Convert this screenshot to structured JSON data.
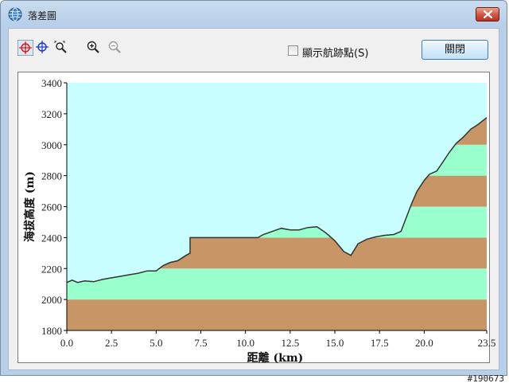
{
  "window": {
    "title": "落差圖"
  },
  "toolbar": {
    "tools": [
      {
        "name": "crosshair-red-icon"
      },
      {
        "name": "crosshair-blue-icon"
      },
      {
        "name": "zoom-area-icon"
      },
      {
        "name": "zoom-in-icon"
      },
      {
        "name": "zoom-out-icon"
      }
    ],
    "show_waypoints_label": "顯示航跡點(S)",
    "show_waypoints_checked": false,
    "close_label": "關閉"
  },
  "watermark": "#190673",
  "colors": {
    "sky": "#c8feff",
    "band_brown": "#c89666",
    "band_green": "#99ffcc",
    "profile_line": "#333333"
  },
  "chart_data": {
    "type": "area",
    "xlabel": "距離  (km)",
    "ylabel": "海拔高度 (m)",
    "xlim": [
      0,
      23.5
    ],
    "ylim": [
      1800,
      3400
    ],
    "xticks": [
      "0.0",
      "2.5",
      "5.0",
      "7.5",
      "10.0",
      "12.5",
      "15.0",
      "17.5",
      "20.0",
      "23.5"
    ],
    "xtick_values": [
      0,
      2.5,
      5,
      7.5,
      10,
      12.5,
      15,
      17.5,
      20,
      23.5
    ],
    "yticks": [
      "1800",
      "2000",
      "2200",
      "2400",
      "2600",
      "2800",
      "3000",
      "3200",
      "3400"
    ],
    "ytick_values": [
      1800,
      2000,
      2200,
      2400,
      2600,
      2800,
      3000,
      3200,
      3400
    ],
    "bands": [
      {
        "from": 1800,
        "to": 2000,
        "fill": "brown"
      },
      {
        "from": 2000,
        "to": 2200,
        "fill": "green"
      },
      {
        "from": 2200,
        "to": 2400,
        "fill": "brown"
      },
      {
        "from": 2400,
        "to": 2600,
        "fill": "green"
      },
      {
        "from": 2600,
        "to": 2800,
        "fill": "brown"
      },
      {
        "from": 2800,
        "to": 3000,
        "fill": "green"
      },
      {
        "from": 3000,
        "to": 3400,
        "fill": "brown"
      }
    ],
    "x": [
      0.0,
      0.3,
      0.6,
      1.0,
      1.5,
      2.0,
      2.5,
      3.0,
      3.5,
      4.0,
      4.5,
      5.0,
      5.4,
      5.8,
      6.2,
      6.6,
      6.9,
      6.9,
      8.0,
      9.0,
      10.0,
      10.7,
      11.0,
      11.5,
      12.0,
      12.5,
      13.0,
      13.5,
      14.0,
      14.5,
      15.0,
      15.5,
      15.9,
      16.3,
      16.8,
      17.3,
      17.8,
      18.3,
      18.7,
      19.0,
      19.3,
      19.6,
      20.0,
      20.3,
      20.7,
      21.0,
      21.4,
      21.8,
      22.2,
      22.6,
      23.0,
      23.5
    ],
    "y": [
      2110,
      2125,
      2110,
      2120,
      2115,
      2130,
      2140,
      2150,
      2160,
      2170,
      2185,
      2185,
      2220,
      2240,
      2250,
      2280,
      2300,
      2400,
      2400,
      2400,
      2400,
      2400,
      2420,
      2440,
      2460,
      2450,
      2450,
      2465,
      2470,
      2430,
      2380,
      2310,
      2285,
      2360,
      2390,
      2405,
      2415,
      2420,
      2440,
      2530,
      2620,
      2700,
      2770,
      2810,
      2830,
      2880,
      2950,
      3010,
      3050,
      3100,
      3130,
      3175
    ]
  }
}
